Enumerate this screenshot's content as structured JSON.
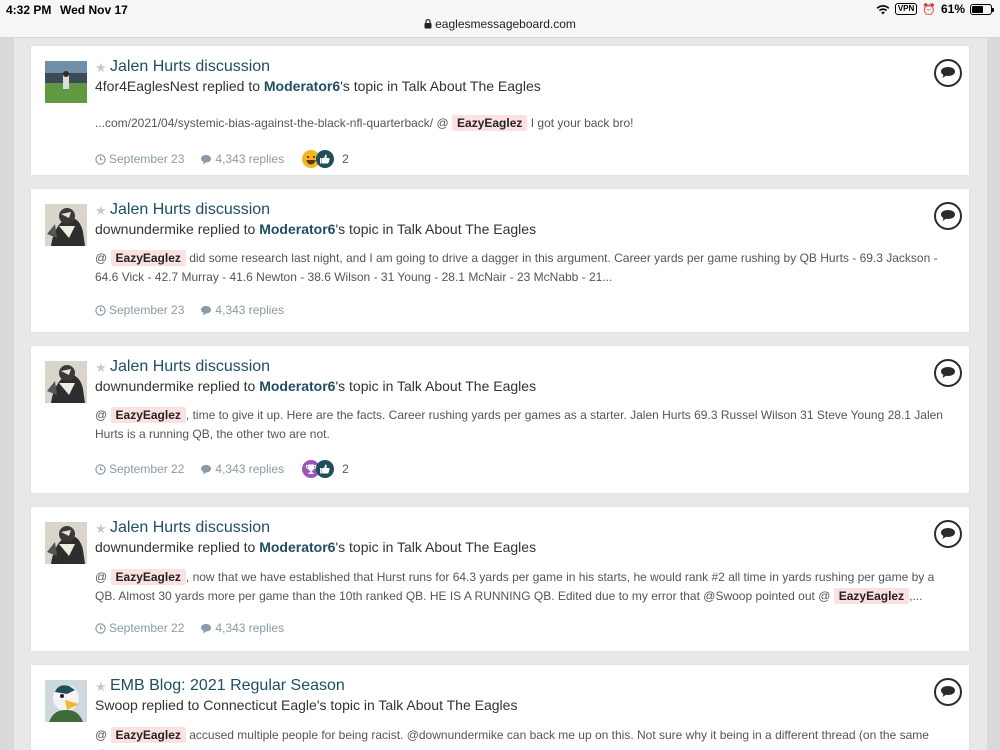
{
  "status_bar": {
    "time": "4:32 PM",
    "date": "Wed Nov 17",
    "vpn": "VPN",
    "battery": "61%",
    "battery_level": 0.61
  },
  "browser": {
    "url": "eaglesmessageboard.com"
  },
  "posts": [
    {
      "title": "Jalen Hurts discussion",
      "author": "4for4EaglesNest",
      "action": " replied to ",
      "topic_owner": "Moderator6",
      "suffix": "'s topic in Talk About The Eagles",
      "body_pre": "...com/2021/04/systemic-bias-against-the-black-nfl-quarterback/ @",
      "mention": "EazyEaglez",
      "body_post": " I got your back bro!",
      "date": "September 23",
      "replies": "4,343 replies",
      "reaction_count": "2",
      "reactions": [
        "laugh",
        "like"
      ],
      "avatar": "stadium-field"
    },
    {
      "title": "Jalen Hurts discussion",
      "author": "downundermike",
      "action": " replied to ",
      "topic_owner": "Moderator6",
      "suffix": "'s topic in Talk About The Eagles",
      "body_pre": "@",
      "mention": "EazyEaglez",
      "body_post": " did some research last night, and I am going to drive a dagger in this argument. Career yards per game rushing by QB Hurts - 69.3 Jackson - 64.6 Vick - 42.7 Murray - 41.6 Newton - 38.6 Wilson - 31 Young - 28.1 McNair - 23 McNabb - 21...",
      "date": "September 23",
      "replies": "4,343 replies",
      "reaction_count": "",
      "reactions": [],
      "avatar": "eagle-mascot"
    },
    {
      "title": "Jalen Hurts discussion",
      "author": "downundermike",
      "action": " replied to ",
      "topic_owner": "Moderator6",
      "suffix": "'s topic in Talk About The Eagles",
      "body_pre": "@",
      "mention": "EazyEaglez",
      "body_post": ", time to give it up. Here are the facts. Career rushing yards per games as a starter. Jalen Hurts 69.3 Russel Wilson 31 Steve Young 28.1 Jalen Hurts is a running QB, the other two are not.",
      "date": "September 22",
      "replies": "4,343 replies",
      "reaction_count": "2",
      "reactions": [
        "trophy",
        "like"
      ],
      "avatar": "eagle-mascot"
    },
    {
      "title": "Jalen Hurts discussion",
      "author": "downundermike",
      "action": " replied to ",
      "topic_owner": "Moderator6",
      "suffix": "'s topic in Talk About The Eagles",
      "body_pre": "@",
      "mention": "EazyEaglez",
      "body_post": ", now that we have established that Hurst runs for 64.3 yards per game in his starts, he would rank #2 all time in yards rushing per game by a QB. Almost 30 yards more per game than the 10th ranked QB. HE IS A RUNNING QB. Edited due to my error that @Swoop pointed out @",
      "mention2": "EazyEaglez",
      "body_post2": ",...",
      "date": "September 22",
      "replies": "4,343 replies",
      "reaction_count": "",
      "reactions": [],
      "avatar": "eagle-mascot"
    },
    {
      "title": "EMB Blog: 2021 Regular Season",
      "author": "Swoop",
      "action": " replied to ",
      "topic_owner": "Connecticut Eagle",
      "suffix": "'s topic in Talk About The Eagles",
      "body_pre": "@",
      "mention": "EazyEaglez",
      "body_post": " accused multiple people for being racist. @downundermike can back me up on this. Not sure why it being in a different thread (on the same site",
      "date": "",
      "replies": "",
      "reaction_count": "",
      "reactions": [],
      "avatar": "swoop-mascot"
    }
  ],
  "colors": {
    "title": "#1f4e63",
    "mention_bg": "#fbe1e2",
    "meta": "#8a9aa6",
    "like": "#1e4d5c",
    "laugh": "#f5b52a",
    "trophy": "#9a58b5"
  }
}
